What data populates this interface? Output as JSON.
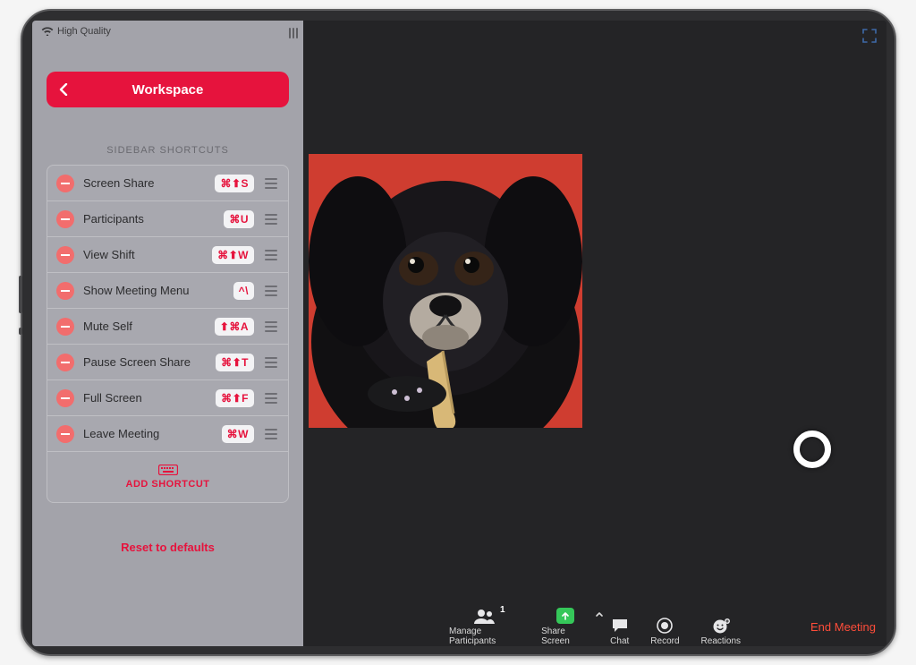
{
  "status": {
    "quality": "High Quality"
  },
  "header": {
    "title": "Workspace"
  },
  "section_label": "SIDEBAR SHORTCUTS",
  "shortcuts": [
    {
      "label": "Screen Share",
      "keys": "⌘⬆S"
    },
    {
      "label": "Participants",
      "keys": "⌘U"
    },
    {
      "label": "View Shift",
      "keys": "⌘⬆W"
    },
    {
      "label": "Show Meeting Menu",
      "keys": "^\\"
    },
    {
      "label": "Mute Self",
      "keys": "⬆⌘A"
    },
    {
      "label": "Pause Screen Share",
      "keys": "⌘⬆T"
    },
    {
      "label": "Full Screen",
      "keys": "⌘⬆F"
    },
    {
      "label": "Leave Meeting",
      "keys": "⌘W"
    }
  ],
  "add_label": "ADD SHORTCUT",
  "reset_label": "Reset to defaults",
  "toolbar": {
    "participants": {
      "label": "Manage Participants",
      "count": "1"
    },
    "share": {
      "label": "Share Screen"
    },
    "chat": {
      "label": "Chat"
    },
    "record": {
      "label": "Record"
    },
    "reactions": {
      "label": "Reactions"
    },
    "end": {
      "label": "End Meeting"
    }
  },
  "colors": {
    "accent": "#e6133d",
    "share_green": "#35c759",
    "end_red": "#ff4d3a"
  }
}
